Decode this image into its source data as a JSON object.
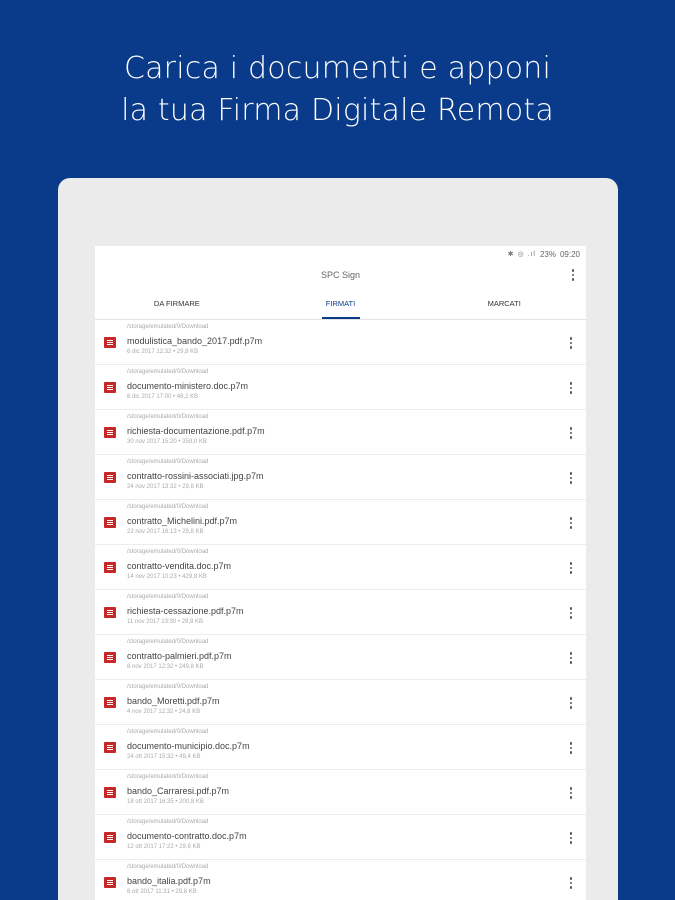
{
  "headline": {
    "line1": "Carica i documenti e apponi",
    "line2": "la tua Firma Digitale Remota"
  },
  "statusbar": {
    "icons": "✱ ◎ .ıl",
    "battery": "23%",
    "time": "09:20"
  },
  "appbar": {
    "title": "SPC Sign",
    "menu_icon": "more-vert-icon"
  },
  "tabs": [
    {
      "label": "DA FIRMARE",
      "active": false
    },
    {
      "label": "FIRMATI",
      "active": true
    },
    {
      "label": "MARCATI",
      "active": false
    }
  ],
  "files": [
    {
      "path": "/storage/emulated/0/Download",
      "name": "modulistica_bando_2017.pdf.p7m",
      "meta": "6 dic 2017 12:32 • 29,8 KB"
    },
    {
      "path": "/storage/emulated/0/Download",
      "name": "documento-ministero.doc.p7m",
      "meta": "6 dic 2017 17:00 • 48,2 KB"
    },
    {
      "path": "/storage/emulated/0/Download",
      "name": "richiesta-documentazione.pdf.p7m",
      "meta": "30 nov 2017 15:20 • 359,0 KB"
    },
    {
      "path": "/storage/emulated/0/Download",
      "name": "contratto-rossini-associati.jpg.p7m",
      "meta": "24 nov 2017 13:32 • 29,8 KB"
    },
    {
      "path": "/storage/emulated/0/Download",
      "name": "contratto_Michelini.pdf.p7m",
      "meta": "22 nov 2017 16:13 • 29,8 KB"
    },
    {
      "path": "/storage/emulated/0/Download",
      "name": "contratto-vendita.doc.p7m",
      "meta": "14 nov 2017 10:23 • 429,8 KB"
    },
    {
      "path": "/storage/emulated/0/Download",
      "name": "richiesta-cessazione.pdf.p7m",
      "meta": "11 nov 2017 13:30 • 29,8 KB"
    },
    {
      "path": "/storage/emulated/0/Download",
      "name": "contratto-palmieri.pdf.p7m",
      "meta": "8 nov 2017 12:32 • 249,8 KB"
    },
    {
      "path": "/storage/emulated/0/Download",
      "name": "bando_Moretti.pdf.p7m",
      "meta": "4 nov 2017 12:32 • 24,8 KB"
    },
    {
      "path": "/storage/emulated/0/Download",
      "name": "documento-municipio.doc.p7m",
      "meta": "24 ott 2017 15:32 • 49,4 KB"
    },
    {
      "path": "/storage/emulated/0/Download",
      "name": "bando_Carraresi.pdf.p7m",
      "meta": "18 ott 2017 16:35 • 200,8 KB"
    },
    {
      "path": "/storage/emulated/0/Download",
      "name": "documento-contratto.doc.p7m",
      "meta": "12 ott 2017 17:22 • 29,8 KB"
    },
    {
      "path": "/storage/emulated/0/Download",
      "name": "bando_italia.pdf.p7m",
      "meta": "8 ott 2017 11:31 • 29,8 KB"
    }
  ],
  "colors": {
    "background": "#0a3a8a",
    "accent": "#0a3a8a",
    "file_icon": "#c62828"
  }
}
